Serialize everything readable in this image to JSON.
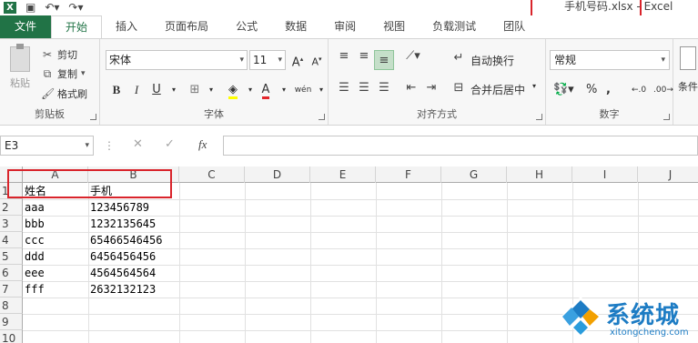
{
  "window": {
    "title": "手机号码.xlsx - Excel",
    "app_color": "#217346",
    "highlight_color": "#d9242b"
  },
  "quick_access": {
    "logo": "X",
    "icons": [
      "save-icon",
      "undo-icon",
      "redo-icon"
    ]
  },
  "tabs": [
    {
      "label": "文件",
      "active": false
    },
    {
      "label": "开始",
      "active": true
    },
    {
      "label": "插入",
      "active": false
    },
    {
      "label": "页面布局",
      "active": false
    },
    {
      "label": "公式",
      "active": false
    },
    {
      "label": "数据",
      "active": false
    },
    {
      "label": "审阅",
      "active": false
    },
    {
      "label": "视图",
      "active": false
    },
    {
      "label": "负载测试",
      "active": false
    },
    {
      "label": "团队",
      "active": false
    }
  ],
  "ribbon": {
    "clipboard": {
      "paste_label": "粘贴",
      "cut_label": "剪切",
      "copy_label": "复制",
      "format_painter_label": "格式刷",
      "group_label": "剪贴板"
    },
    "font": {
      "font_name": "宋体",
      "font_size": "11",
      "group_label": "字体",
      "bold": "B",
      "italic": "I",
      "underline": "U",
      "font_color": "A",
      "phonetic": "wén"
    },
    "alignment": {
      "wrap_text_label": "自动换行",
      "merge_center_label": "合并后居中",
      "group_label": "对齐方式"
    },
    "number": {
      "format": "常规",
      "percent": "%",
      "comma": ",",
      "group_label": "数字"
    },
    "conditional": {
      "label": "条件"
    }
  },
  "formula_bar": {
    "name_box": "E3",
    "cancel": "✕",
    "enter": "✓",
    "fx": "fx",
    "content": ""
  },
  "grid": {
    "columns": [
      "A",
      "B",
      "C",
      "D",
      "E",
      "F",
      "G",
      "H",
      "I",
      "J"
    ],
    "rows": [
      "1",
      "2",
      "3",
      "4",
      "5",
      "6",
      "7",
      "8",
      "9",
      "10"
    ],
    "cells": [
      [
        "姓名",
        "手机"
      ],
      [
        "aaa",
        "123456789"
      ],
      [
        "bbb",
        "1232135645"
      ],
      [
        "ccc",
        "65466546456"
      ],
      [
        "ddd",
        "6456456456"
      ],
      [
        "eee",
        "4564564564"
      ],
      [
        "fff",
        "2632132123"
      ]
    ]
  },
  "watermark": {
    "text": "系统城",
    "subtext": "xitongcheng.com",
    "color": "#1d7cc4"
  }
}
